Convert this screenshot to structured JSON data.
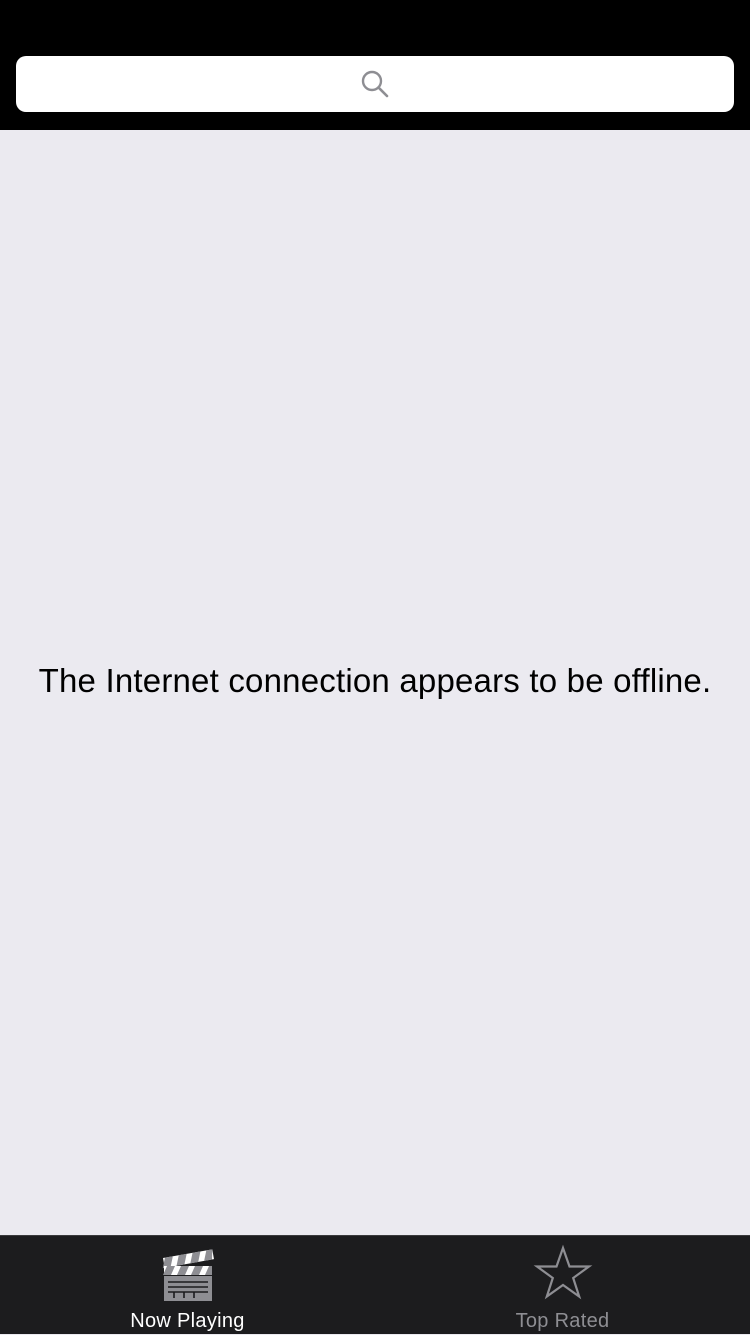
{
  "search": {
    "value": "",
    "placeholder": "",
    "icon": "search-icon"
  },
  "message": {
    "text": "The Internet connection appears to be offline."
  },
  "tabs": [
    {
      "label": "Now Playing",
      "icon": "clapperboard-icon",
      "selected": true,
      "color": "#ffffff"
    },
    {
      "label": "Top Rated",
      "icon": "star-icon",
      "selected": false,
      "color": "#8e8e93"
    }
  ],
  "colors": {
    "top_bar": "#000000",
    "background": "#ebeaf0",
    "tab_bar": "#1c1c1e"
  }
}
